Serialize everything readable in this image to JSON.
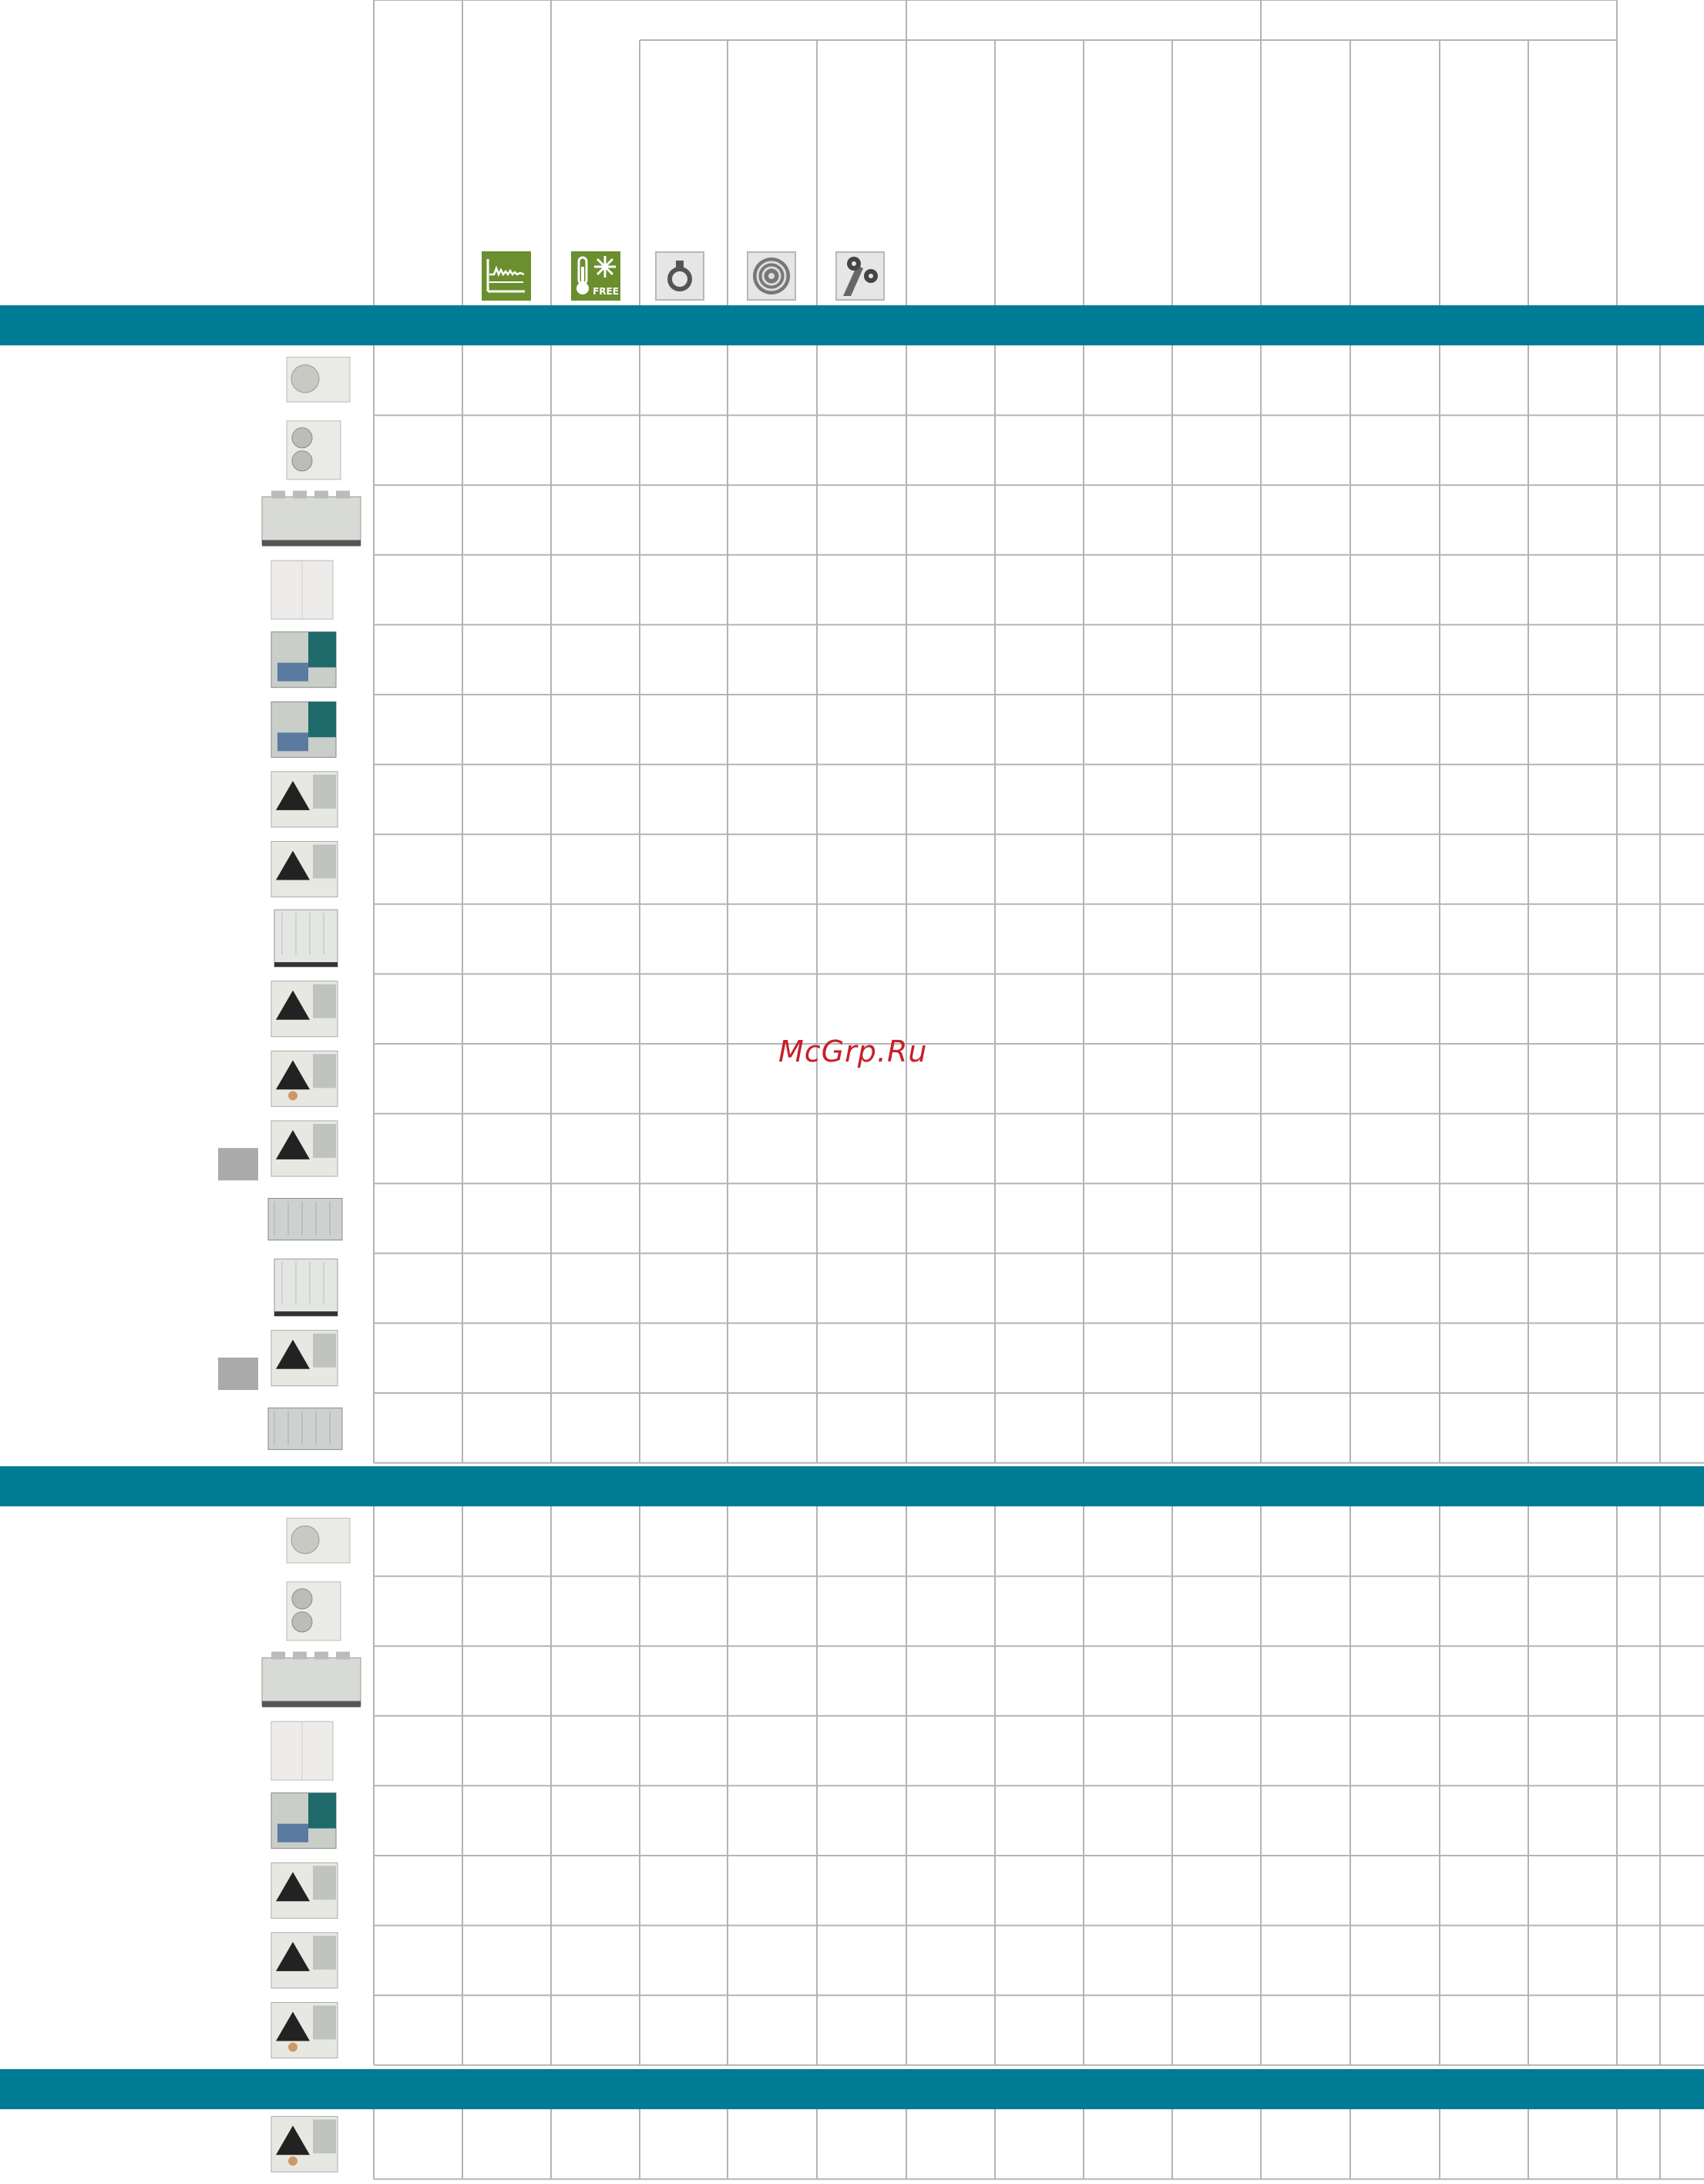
{
  "colors": {
    "band": "#007b96",
    "grid_line": "#b4b4b4",
    "icon_green": "#6b8e2e",
    "watermark": "#c8202a"
  },
  "header_icons": [
    {
      "name": "capacity-curve-icon",
      "label": ""
    },
    {
      "name": "free-cooling-icon",
      "label": "FREE"
    },
    {
      "name": "screw-compressor-icon",
      "label": ""
    },
    {
      "name": "scroll-compressor-icon",
      "label": ""
    },
    {
      "name": "centrifugal-gears-icon",
      "label": ""
    }
  ],
  "sections": [
    {
      "rows": 16
    },
    {
      "rows": 8
    },
    {
      "rows": 1
    }
  ],
  "section_1_products": [
    "split-unit",
    "split-unit-2fan",
    "large-rooftop-unit",
    "box-unit",
    "v-coil-chiller-teal",
    "v-coil-chiller-teal",
    "v-coil-chiller",
    "v-coil-chiller",
    "box-chiller",
    "v-coil-chiller",
    "v-coil-chiller-variant",
    "v-coil-chiller",
    "long-chiller",
    "box-chiller-large",
    "v-coil-chiller",
    "long-chiller"
  ],
  "section_2_products": [
    "split-unit",
    "split-unit-2fan",
    "large-rooftop-unit",
    "box-unit",
    "v-coil-chiller-teal",
    "v-coil-chiller",
    "v-coil-chiller",
    "v-coil-chiller-variant"
  ],
  "section_3_products": [
    "v-coil-chiller-variant"
  ],
  "watermark": "McGrp.Ru"
}
